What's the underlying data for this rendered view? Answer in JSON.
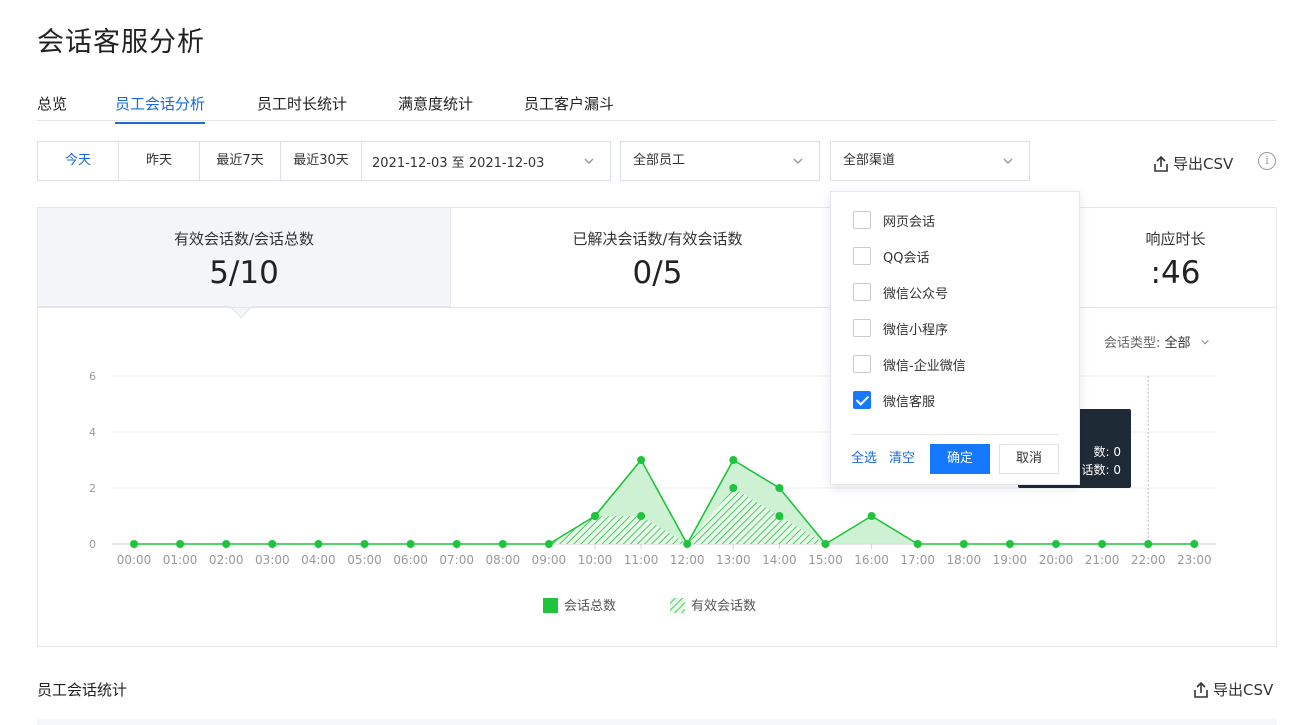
{
  "page_title": "会话客服分析",
  "tabs": [
    {
      "label": "总览"
    },
    {
      "label": "员工会话分析",
      "active": true
    },
    {
      "label": "员工时长统计"
    },
    {
      "label": "满意度统计"
    },
    {
      "label": "员工客户漏斗"
    }
  ],
  "filters": {
    "quick_dates": [
      "今天",
      "昨天",
      "最近7天",
      "最近30天"
    ],
    "active_quick_date": "今天",
    "date_range": "2021-12-03 至 2021-12-03",
    "staff_select": "全部员工",
    "channel_select": "全部渠道"
  },
  "export_label": "导出CSV",
  "metrics": [
    {
      "label": "有效会话数/会话总数",
      "value": "5/10"
    },
    {
      "label": "已解决会话数/有效会话数",
      "value": "0/5"
    },
    {
      "label": "响应时长",
      "value": ":46"
    }
  ],
  "session_type": {
    "label": "会话类型:",
    "value": "全部"
  },
  "channel_dropdown": {
    "options": [
      {
        "label": "网页会话",
        "checked": false
      },
      {
        "label": "QQ会话",
        "checked": false
      },
      {
        "label": "微信公众号",
        "checked": false
      },
      {
        "label": "微信小程序",
        "checked": false
      },
      {
        "label": "微信-企业微信",
        "checked": false
      },
      {
        "label": "微信客服",
        "checked": true
      }
    ],
    "select_all": "全选",
    "clear": "清空",
    "confirm": "确定",
    "cancel": "取消"
  },
  "tooltip": {
    "line1": "数: 0",
    "line2": "话数: 0"
  },
  "colors": {
    "accent": "#1677ff",
    "series": "#1ec43c",
    "series_fill": "#c7efcb"
  },
  "chart_data": {
    "type": "area",
    "x": [
      "00:00",
      "01:00",
      "02:00",
      "03:00",
      "04:00",
      "05:00",
      "06:00",
      "07:00",
      "08:00",
      "09:00",
      "10:00",
      "11:00",
      "12:00",
      "13:00",
      "14:00",
      "15:00",
      "16:00",
      "17:00",
      "18:00",
      "19:00",
      "20:00",
      "21:00",
      "22:00",
      "23:00"
    ],
    "series": [
      {
        "name": "会话总数",
        "style": "solid",
        "values": [
          0,
          0,
          0,
          0,
          0,
          0,
          0,
          0,
          0,
          0,
          1,
          3,
          0,
          3,
          2,
          0,
          1,
          0,
          0,
          0,
          0,
          0,
          0,
          0
        ]
      },
      {
        "name": "有效会话数",
        "style": "hatched",
        "values": [
          0,
          0,
          0,
          0,
          0,
          0,
          0,
          0,
          0,
          0,
          1,
          1,
          0,
          2,
          1,
          0,
          0,
          0,
          0,
          0,
          0,
          0,
          0,
          0
        ]
      }
    ],
    "yticks": [
      0,
      2,
      4,
      6
    ],
    "ylim": [
      0,
      6
    ],
    "grid": true,
    "legend": "bottom"
  },
  "bottom_section": {
    "title": "员工会话统计"
  }
}
